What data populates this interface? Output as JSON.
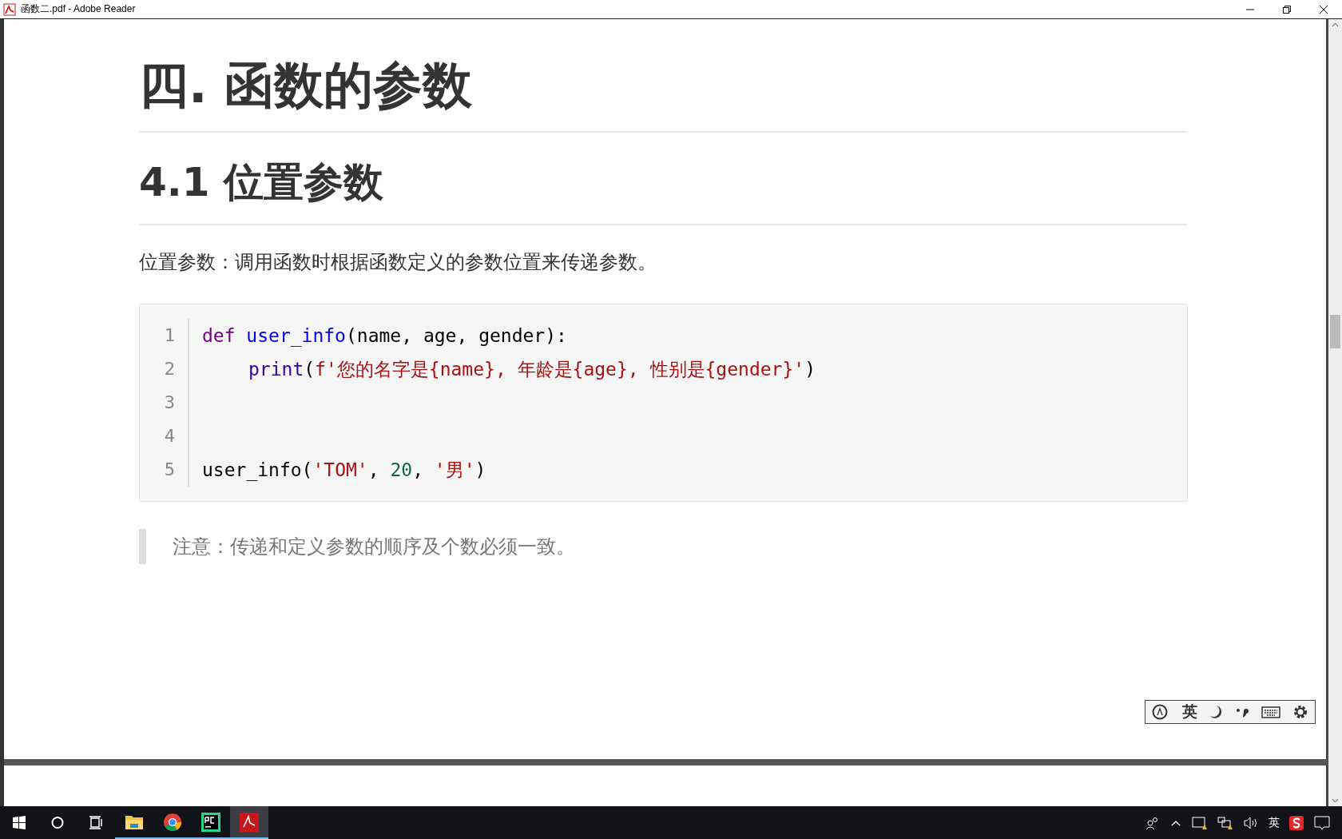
{
  "window": {
    "title": "函数二.pdf - Adobe Reader"
  },
  "document": {
    "heading": "四. 函数的参数",
    "subheading": "4.1 位置参数",
    "paragraph": "位置参数：调用函数时根据函数定义的参数位置来传递参数。",
    "code": [
      {
        "number": "1",
        "indented": false,
        "tokens": [
          {
            "kind": "keyword",
            "text": "def"
          },
          {
            "kind": "definition",
            "text": "user_info",
            "space_before": true
          },
          {
            "kind": "plain",
            "text": "(name, age, gender):"
          }
        ]
      },
      {
        "number": "2",
        "indented": true,
        "tokens": [
          {
            "kind": "builtin",
            "text": "print"
          },
          {
            "kind": "plain",
            "text": "("
          },
          {
            "kind": "string",
            "text": "f'您的名字是{name}, 年龄是{age}, 性别是{gender}'"
          },
          {
            "kind": "plain",
            "text": ")"
          }
        ]
      },
      {
        "number": "3",
        "indented": false
      },
      {
        "number": "4",
        "indented": false
      },
      {
        "number": "5",
        "indented": false,
        "tokens": [
          {
            "kind": "plain",
            "text": "user_info("
          },
          {
            "kind": "string",
            "text": "'TOM'"
          },
          {
            "kind": "plain",
            "text": ", "
          },
          {
            "kind": "number",
            "text": "20"
          },
          {
            "kind": "plain",
            "text": ", "
          },
          {
            "kind": "string",
            "text": "'男'"
          },
          {
            "kind": "plain",
            "text": ")"
          }
        ]
      }
    ],
    "note": "注意：传递和定义参数的顺序及个数必须一致。"
  },
  "ime_toolbar": {
    "mode": "英"
  },
  "taskbar": {
    "apps": [
      {
        "kind": "explorer",
        "active": false
      },
      {
        "kind": "chrome",
        "active": false
      },
      {
        "kind": "pycharm",
        "active": false
      },
      {
        "kind": "reader",
        "active": true
      }
    ],
    "input_language": "英"
  }
}
